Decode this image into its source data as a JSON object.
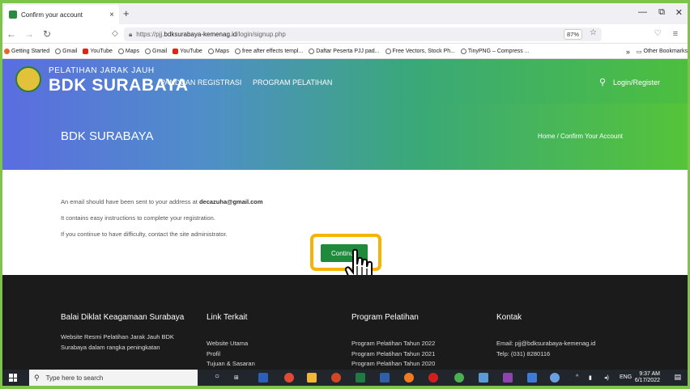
{
  "browser": {
    "tab_title": "Confirm your account",
    "tab_close": "×",
    "new_tab": "+",
    "url_prefix": "https://pjj.",
    "url_domain": "bdksurabaya-kemenag.id",
    "url_path": "/login/signup.php",
    "zoom": "87%",
    "window_controls": [
      "—",
      "⧉",
      "✕"
    ]
  },
  "bookmarks": {
    "items": [
      {
        "label": "Getting Started",
        "icon": "getting-started-icon"
      },
      {
        "label": "Gmail",
        "icon": "globe-icon"
      },
      {
        "label": "YouTube",
        "icon": "youtube-icon"
      },
      {
        "label": "Maps",
        "icon": "globe-icon"
      },
      {
        "label": "Gmail",
        "icon": "globe-icon"
      },
      {
        "label": "YouTube",
        "icon": "youtube-icon"
      },
      {
        "label": "Maps",
        "icon": "globe-icon"
      },
      {
        "label": "free after effects templ...",
        "icon": "globe-icon"
      },
      {
        "label": "Daftar Peserta PJJ pad...",
        "icon": "globe-icon"
      },
      {
        "label": "Free Vectors, Stock Ph...",
        "icon": "globe-icon"
      },
      {
        "label": "TinyPNG – Compress ...",
        "icon": "globe-icon"
      }
    ],
    "more": "»",
    "other": "Other Bookmarks"
  },
  "site": {
    "brand_top": "PELATIHAN JARAK JAUH",
    "brand_main": "BDK SURABAYA",
    "menu": [
      "PANDUAN REGISTRASI",
      "PROGRAM PELATIHAN"
    ],
    "login": "Login/Register"
  },
  "hero": {
    "title": "BDK SURABAYA",
    "breadcrumb": "Home  /  Confirm Your Account"
  },
  "message": {
    "line1_prefix": "An email should have been sent to your address at ",
    "email": "decazuha@gmail.com",
    "line2": "It contains easy instructions to complete your registration.",
    "line3": "If you continue to have difficulty, contact the site administrator.",
    "button": "Continue"
  },
  "footer": {
    "col1_title": "Balai Diklat Keagamaan Surabaya",
    "col1_text": [
      "Website Resmi Pelatihan Jarak Jauh BDK",
      "Surabaya dalam rangka peningkatan"
    ],
    "col2_title": "Link Terkait",
    "col2_links": [
      "Website Utama",
      "Profil",
      "Tujuan & Sasaran"
    ],
    "col3_title": "Program Pelatihan",
    "col3_links": [
      "Program Pelatihan Tahun 2022",
      "Program Pelatihan Tahun 2021",
      "Program Pelatihan Tahun 2020"
    ],
    "col4_title": "Kontak",
    "col4_links": [
      "Email: pjj@bdksurabaya-kemenag.id",
      "Telp: (031) 8280116"
    ]
  },
  "taskbar": {
    "search_placeholder": "Type here to search",
    "lang": "ENG",
    "time": "9:37 AM",
    "date": "6/17/2022"
  },
  "colors": {
    "accent_green": "#1f8a3c",
    "highlight": "#f6b400",
    "footer_bg": "#1b1b1b"
  }
}
